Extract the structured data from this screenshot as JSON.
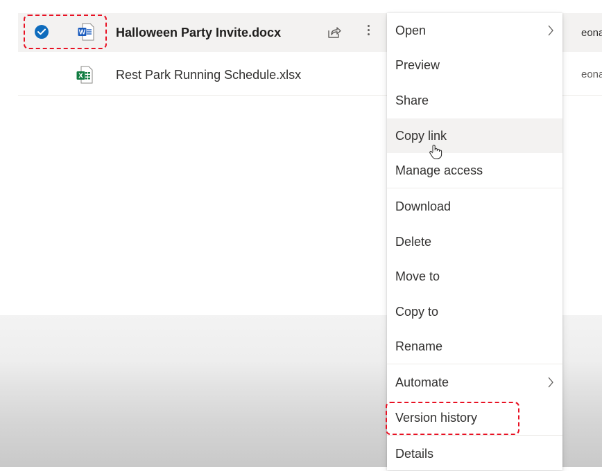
{
  "files": [
    {
      "name": "Halloween Party Invite.docx",
      "type_icon": "word-file-icon",
      "selected": true,
      "modified_by": "eonard A"
    },
    {
      "name": "Rest Park Running Schedule.xlsx",
      "type_icon": "excel-file-icon",
      "selected": false,
      "modified_by": "eonard A"
    }
  ],
  "context_menu": {
    "items": [
      {
        "label": "Open",
        "has_submenu": true
      },
      {
        "label": "Preview"
      },
      {
        "label": "Share"
      },
      {
        "label": "Copy link",
        "hovered": true
      },
      {
        "label": "Manage access"
      },
      {
        "label": "Download"
      },
      {
        "label": "Delete"
      },
      {
        "label": "Move to"
      },
      {
        "label": "Copy to"
      },
      {
        "label": "Rename"
      },
      {
        "label": "Automate",
        "has_submenu": true
      },
      {
        "label": "Version history",
        "highlighted": true
      },
      {
        "label": "Details"
      }
    ]
  },
  "icons": {
    "word_letter": "W",
    "excel_letter": "X"
  },
  "colors": {
    "accent": "#0f6cbd",
    "word_blue": "#185abd",
    "excel_green": "#107c41",
    "annotation_red": "#e81123",
    "selected_row_bg": "#f3f2f1"
  }
}
